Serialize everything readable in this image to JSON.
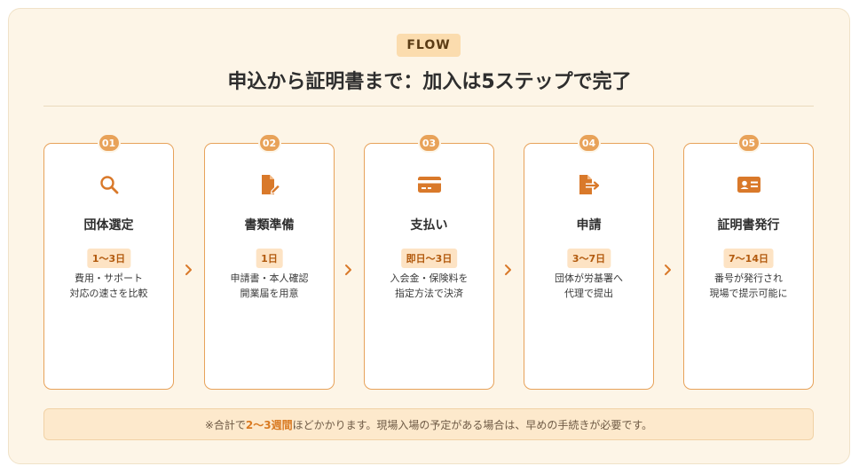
{
  "badge": "FLOW",
  "title": "申込から証明書まで：加入は5ステップで完了",
  "steps": [
    {
      "num": "01",
      "icon": "search-icon",
      "title": "団体選定",
      "duration": "1〜3日",
      "desc": [
        "費用・サポート",
        "対応の速さを比較"
      ]
    },
    {
      "num": "02",
      "icon": "document-edit-icon",
      "title": "書類準備",
      "duration": "1日",
      "desc": [
        "申請書・本人確認",
        "開業届を用意"
      ]
    },
    {
      "num": "03",
      "icon": "credit-card-icon",
      "title": "支払い",
      "duration": "即日〜3日",
      "desc": [
        "入会金・保険料を",
        "指定方法で決済"
      ]
    },
    {
      "num": "04",
      "icon": "file-export-icon",
      "title": "申請",
      "duration": "3〜7日",
      "desc": [
        "団体が労基署へ",
        "代理で提出"
      ]
    },
    {
      "num": "05",
      "icon": "id-card-icon",
      "title": "証明書発行",
      "duration": "7〜14日",
      "desc": [
        "番号が発行され",
        "現場で提示可能に"
      ]
    }
  ],
  "note": {
    "prefix": "※合計で",
    "highlight": "2〜3週間",
    "suffix": "ほどかかります。現場入場の予定がある場合は、早めの手続きが必要です。"
  },
  "colors": {
    "accent": "#e8a259",
    "background": "#fdf5e7",
    "badge_bg": "#fbdcae",
    "note_bg": "#fde9cc"
  }
}
